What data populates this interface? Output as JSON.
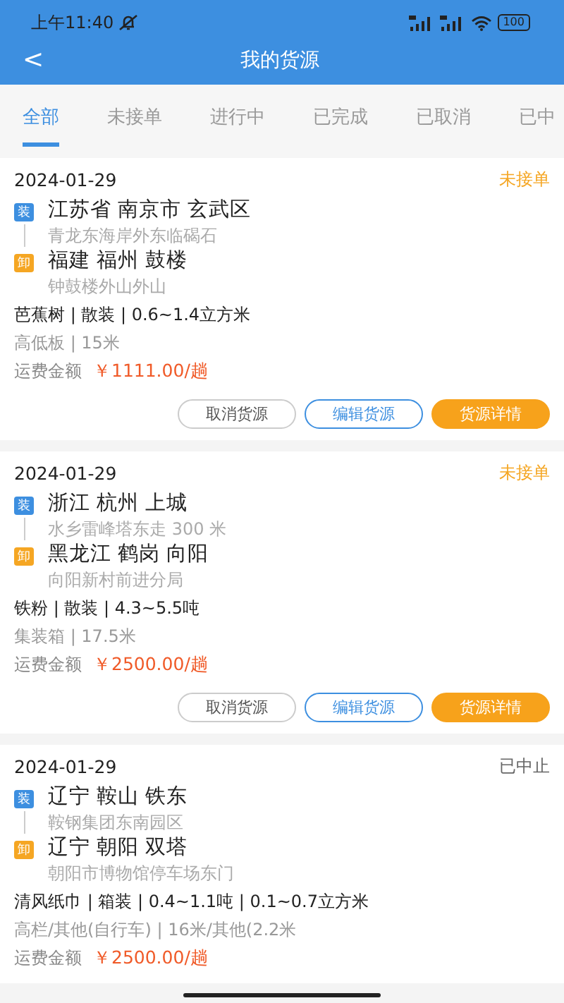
{
  "status_bar": {
    "time": "上午11:40",
    "battery": "100"
  },
  "header": {
    "title": "我的货源",
    "back": "<"
  },
  "tabs": [
    {
      "label": "全部",
      "selected": true
    },
    {
      "label": "未接单",
      "selected": false
    },
    {
      "label": "进行中",
      "selected": false
    },
    {
      "label": "已完成",
      "selected": false
    },
    {
      "label": "已取消",
      "selected": false
    },
    {
      "label": "已中",
      "selected": false
    }
  ],
  "cargo": [
    {
      "date": "2024-01-29",
      "status": {
        "text": "未接单",
        "color": "#f5a623"
      },
      "stops": [
        {
          "kind": "load",
          "tag": "装",
          "place": "江苏省 南京市 玄武区",
          "detail": "青龙东海岸外东临碣石"
        },
        {
          "kind": "unload",
          "tag": "卸",
          "place": "福建 福州 鼓楼",
          "detail": "钟鼓楼外山外山"
        }
      ],
      "goods": "芭蕉树 | 散装 | 0.6~1.4立方米",
      "truck": "高低板 | 15米",
      "fee_label": "运费金额",
      "fee": "￥1111.00/趟",
      "buttons": [
        {
          "kind": "cancel",
          "label": "取消货源"
        },
        {
          "kind": "edit",
          "label": "编辑货源"
        },
        {
          "kind": "detail",
          "label": "货源详情"
        }
      ]
    },
    {
      "date": "2024-01-29",
      "status": {
        "text": "未接单",
        "color": "#f5a623"
      },
      "stops": [
        {
          "kind": "load",
          "tag": "装",
          "place": "浙江 杭州 上城",
          "detail": "水乡雷峰塔东走 300 米"
        },
        {
          "kind": "unload",
          "tag": "卸",
          "place": "黑龙江 鹤岗 向阳",
          "detail": "向阳新村前进分局"
        }
      ],
      "goods": "铁粉 | 散装 | 4.3~5.5吨",
      "truck": "集装箱 | 17.5米",
      "fee_label": "运费金额",
      "fee": "￥2500.00/趟",
      "buttons": [
        {
          "kind": "cancel",
          "label": "取消货源"
        },
        {
          "kind": "edit",
          "label": "编辑货源"
        },
        {
          "kind": "detail",
          "label": "货源详情"
        }
      ]
    },
    {
      "date": "2024-01-29",
      "status": {
        "text": "已中止",
        "color": "#666666"
      },
      "stops": [
        {
          "kind": "load",
          "tag": "装",
          "place": "辽宁 鞍山 铁东",
          "detail": "鞍钢集团东南园区"
        },
        {
          "kind": "unload",
          "tag": "卸",
          "place": "辽宁 朝阳 双塔",
          "detail": "朝阳市博物馆停车场东门"
        }
      ],
      "goods": "清风纸巾 | 箱装 | 0.4~1.1吨 | 0.1~0.7立方米",
      "truck": "高栏/其他(自行车) | 16米/其他(2.2米",
      "fee_label": "运费金额",
      "fee": "￥2500.00/趟"
    }
  ]
}
